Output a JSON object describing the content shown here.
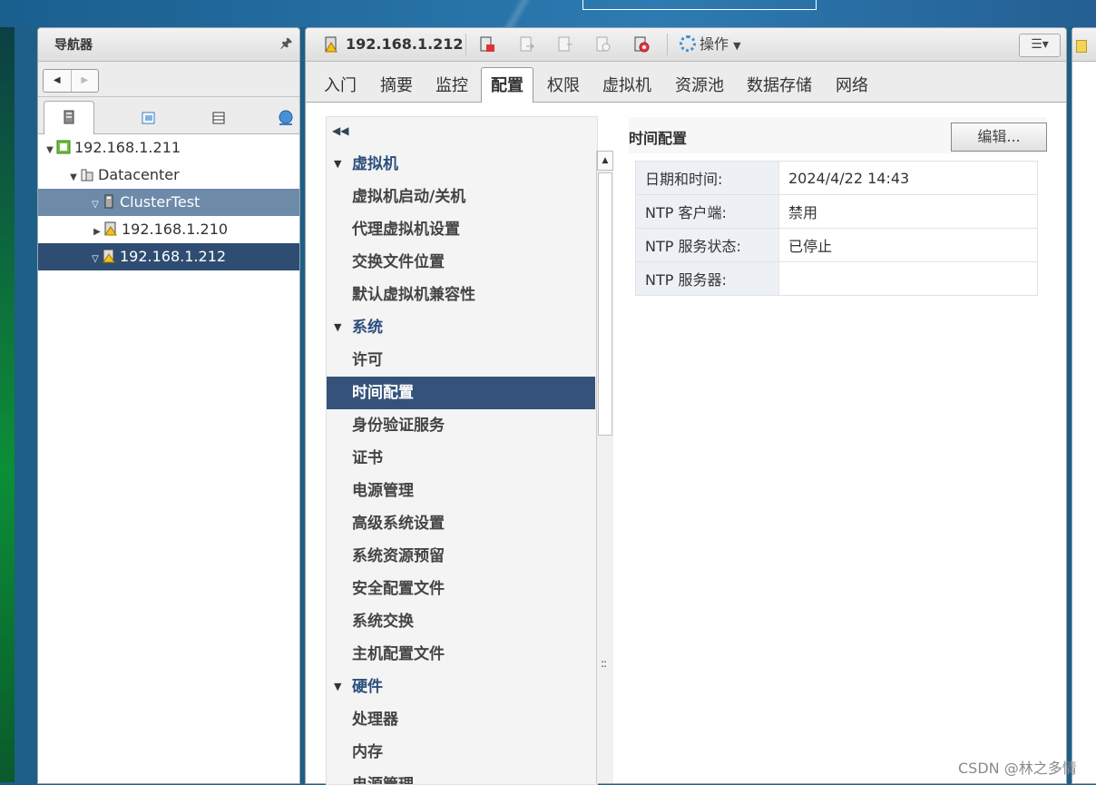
{
  "navigator": {
    "title": "导航器",
    "back_arrow": "◀",
    "forward_arrow": "▶",
    "tree": [
      {
        "label": "192.168.1.211",
        "icon": "vcenter-icon"
      },
      {
        "label": "Datacenter",
        "icon": "datacenter-icon"
      },
      {
        "label": "ClusterTest",
        "icon": "cluster-icon"
      },
      {
        "label": "192.168.1.210",
        "icon": "host-warning-icon"
      },
      {
        "label": "192.168.1.212",
        "icon": "host-warning-icon"
      }
    ]
  },
  "main": {
    "object_title": "192.168.1.212",
    "actions_label": "操作",
    "tabs": [
      "入门",
      "摘要",
      "监控",
      "配置",
      "权限",
      "虚拟机",
      "资源池",
      "数据存储",
      "网络"
    ],
    "active_tab": "配置"
  },
  "config_menu": {
    "sections": [
      {
        "title": "虚拟机",
        "items": [
          "虚拟机启动/关机",
          "代理虚拟机设置",
          "交换文件位置",
          "默认虚拟机兼容性"
        ]
      },
      {
        "title": "系统",
        "items": [
          "许可",
          "时间配置",
          "身份验证服务",
          "证书",
          "电源管理",
          "高级系统设置",
          "系统资源预留",
          "安全配置文件",
          "系统交换",
          "主机配置文件"
        ]
      },
      {
        "title": "硬件",
        "items": [
          "处理器",
          "内存",
          "电源管理"
        ]
      }
    ],
    "selected": "时间配置"
  },
  "detail": {
    "title": "时间配置",
    "edit_label": "编辑...",
    "rows": [
      {
        "key": "日期和时间:",
        "value": "2024/4/22 14:43"
      },
      {
        "key": "NTP 客户端:",
        "value": "禁用"
      },
      {
        "key": "NTP 服务状态:",
        "value": "已停止"
      },
      {
        "key": "NTP 服务器:",
        "value": ""
      }
    ]
  },
  "watermark": "CSDN @林之多情",
  "colors": {
    "selection_dark": "#35537a",
    "selection_light": "#6d8aa9",
    "accent": "#2c4f7c"
  }
}
